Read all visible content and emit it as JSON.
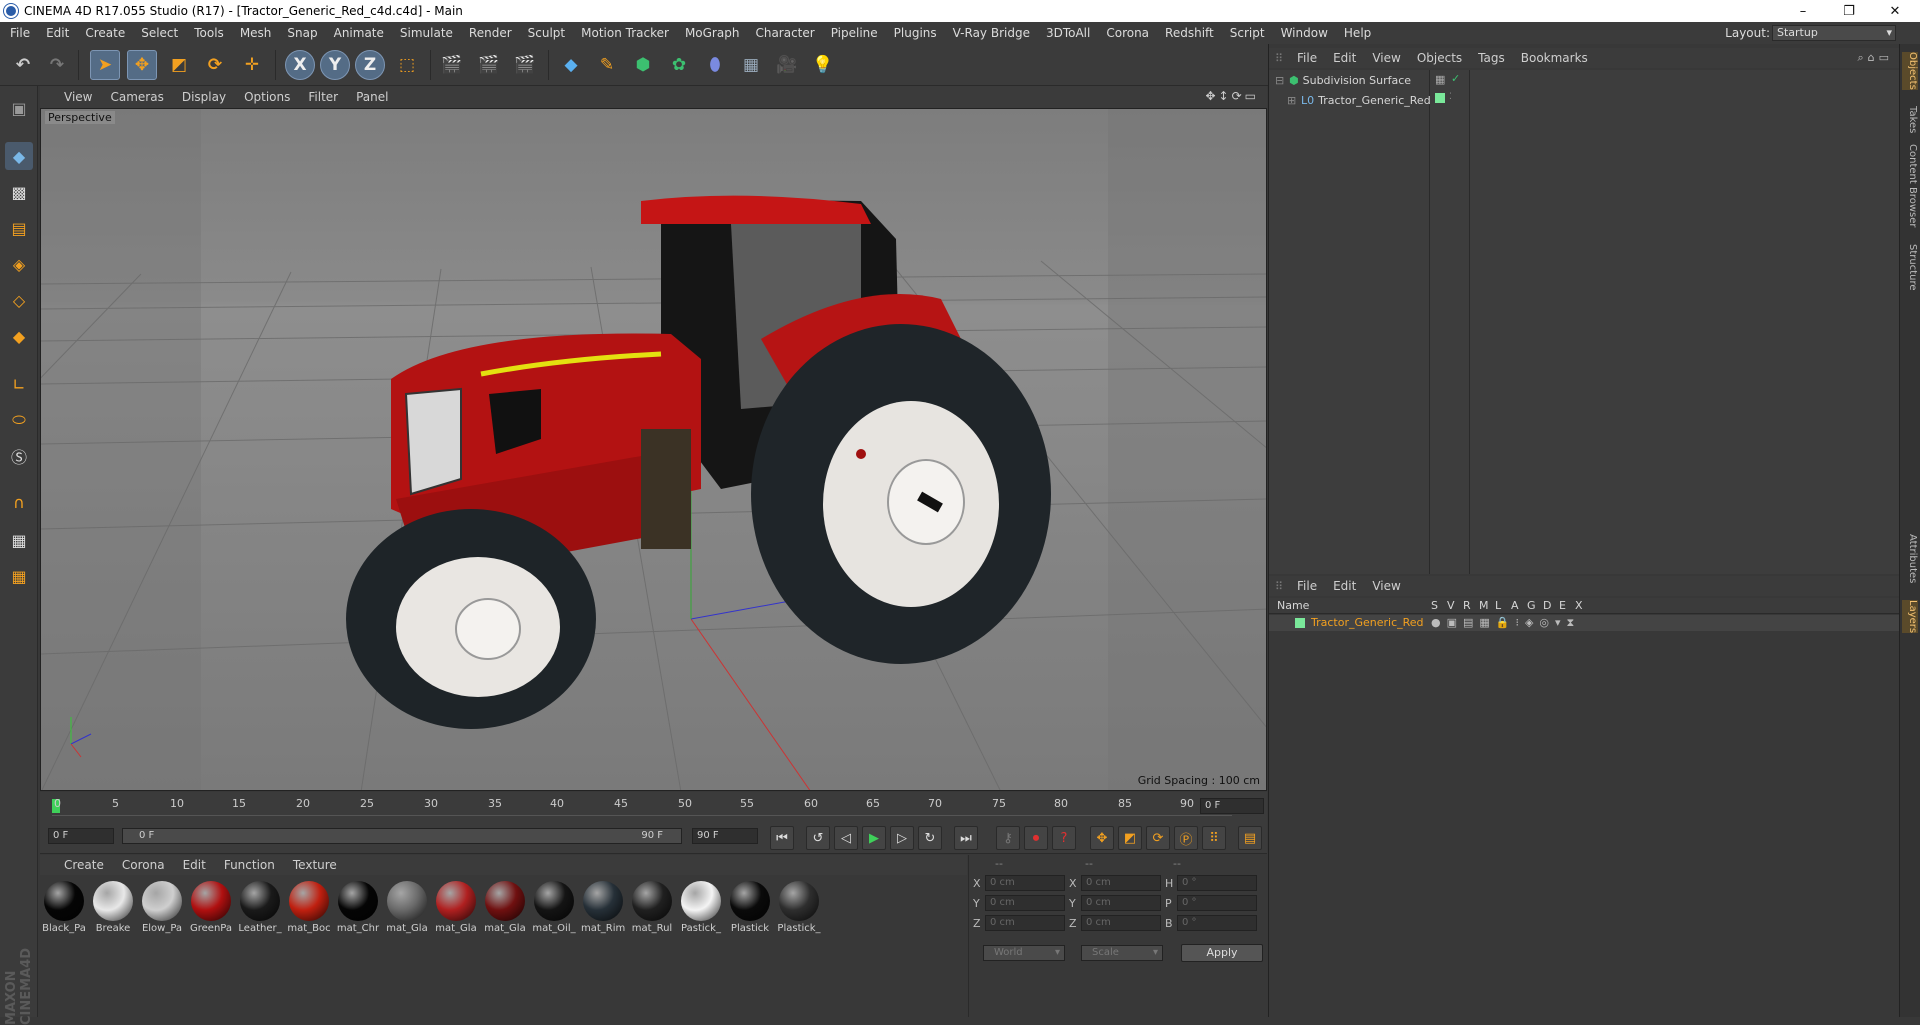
{
  "window": {
    "title": "CINEMA 4D R17.055 Studio (R17) - [Tractor_Generic_Red_c4d.c4d] - Main",
    "controls": [
      "–",
      "❐",
      "✕"
    ]
  },
  "menubar": {
    "items": [
      "File",
      "Edit",
      "Create",
      "Select",
      "Tools",
      "Mesh",
      "Snap",
      "Animate",
      "Simulate",
      "Render",
      "Sculpt",
      "Motion Tracker",
      "MoGraph",
      "Character",
      "Pipeline",
      "Plugins",
      "V-Ray Bridge",
      "3DToAll",
      "Corona",
      "Redshift",
      "Script",
      "Window",
      "Help"
    ],
    "layout_label": "Layout:",
    "layout_value": "Startup"
  },
  "toolbar": {
    "axis_x": "X",
    "axis_y": "Y",
    "axis_z": "Z"
  },
  "viewport": {
    "menu": [
      "View",
      "Cameras",
      "Display",
      "Options",
      "Filter",
      "Panel"
    ],
    "label": "Perspective",
    "grid_spacing": "Grid Spacing : 100 cm"
  },
  "timeline": {
    "ticks": [
      "0",
      "5",
      "10",
      "15",
      "20",
      "25",
      "30",
      "35",
      "40",
      "45",
      "50",
      "55",
      "60",
      "65",
      "70",
      "75",
      "80",
      "85",
      "90"
    ],
    "current_frame": "0 F",
    "start_field": "0 F",
    "range_start": "0 F",
    "range_end": "90 F",
    "end_field": "90 F"
  },
  "materials": {
    "menu": [
      "Create",
      "Corona",
      "Edit",
      "Function",
      "Texture"
    ],
    "items": [
      {
        "name": "Black_Pa",
        "color": "#050505"
      },
      {
        "name": "Breake",
        "color": "#e8e8e8"
      },
      {
        "name": "Elow_Pa",
        "color": "#cfcfcf"
      },
      {
        "name": "GreenPa",
        "color": "#b01010"
      },
      {
        "name": "Leather_",
        "color": "#1a1a1a"
      },
      {
        "name": "mat_Boc",
        "color": "#c02010"
      },
      {
        "name": "mat_Chr",
        "color": "#050505"
      },
      {
        "name": "mat_Gla",
        "color": "#6a6a6a"
      },
      {
        "name": "mat_Gla",
        "color": "#b02020"
      },
      {
        "name": "mat_Gla",
        "color": "#701010"
      },
      {
        "name": "mat_Oil_",
        "color": "#141414"
      },
      {
        "name": "mat_Rim",
        "color": "#263038"
      },
      {
        "name": "mat_Rul",
        "color": "#202020"
      },
      {
        "name": "Pastick_",
        "color": "#f4f4f4"
      },
      {
        "name": "Plastick",
        "color": "#0a0a0a"
      },
      {
        "name": "Plastick_",
        "color": "#2e2e2e"
      }
    ]
  },
  "coords": {
    "headers": [
      "--",
      "--",
      "--"
    ],
    "rows": [
      {
        "a": "X",
        "av": "0 cm",
        "b": "X",
        "bv": "0 cm",
        "c": "H",
        "cv": "0 °"
      },
      {
        "a": "Y",
        "av": "0 cm",
        "b": "Y",
        "bv": "0 cm",
        "c": "P",
        "cv": "0 °"
      },
      {
        "a": "Z",
        "av": "0 cm",
        "b": "Z",
        "bv": "0 cm",
        "c": "B",
        "cv": "0 °"
      }
    ],
    "world": "World",
    "scale": "Scale",
    "apply": "Apply"
  },
  "objects": {
    "menu": [
      "File",
      "Edit",
      "View",
      "Objects",
      "Tags",
      "Bookmarks"
    ],
    "tree": [
      {
        "name": "Subdivision Surface"
      },
      {
        "name": "Tractor_Generic_Red"
      }
    ]
  },
  "layers": {
    "menu": [
      "File",
      "Edit",
      "View"
    ],
    "col_name": "Name",
    "cols": [
      "S",
      "V",
      "R",
      "M",
      "L",
      "A",
      "G",
      "D",
      "E",
      "X"
    ],
    "row": "Tractor_Generic_Red"
  },
  "side_tabs": [
    "Objects",
    "Takes",
    "Content Browser",
    "Structure",
    "Attributes",
    "Layers"
  ],
  "brand": "MAXON CINEMA4D"
}
